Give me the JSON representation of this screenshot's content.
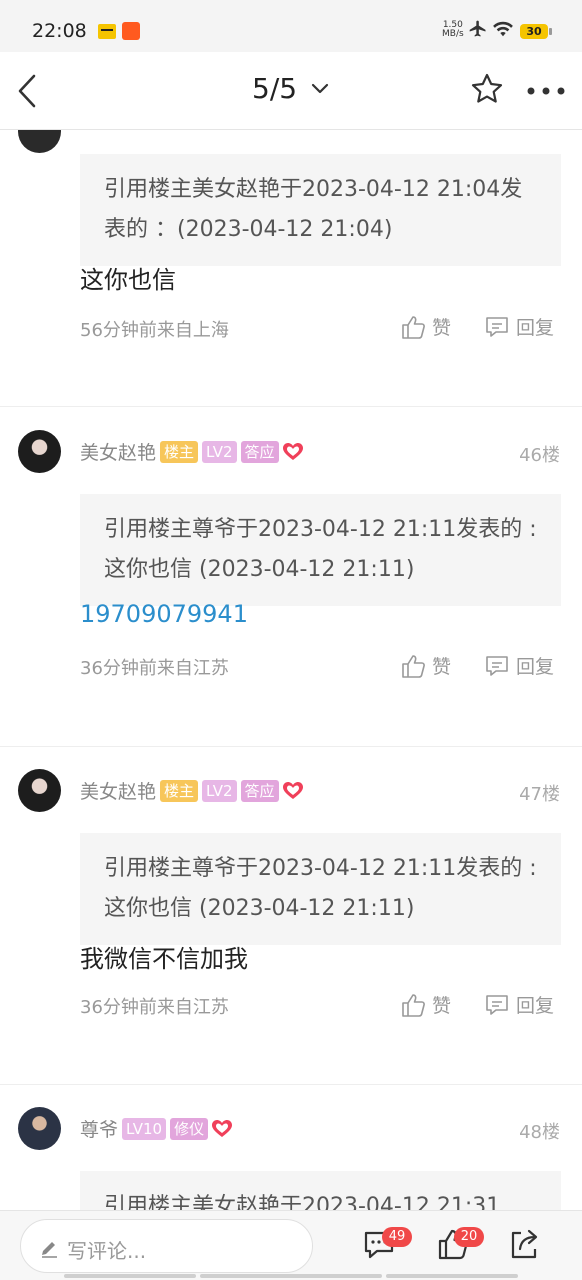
{
  "status_bar": {
    "time": "22:08",
    "net_speed_value": "1.50",
    "net_speed_unit": "MB/s",
    "battery": "30"
  },
  "nav": {
    "page_indicator": "5/5"
  },
  "posts": [
    {
      "quote": "引用楼主美女赵艳于2023-04-12 21:04发表的 ：(2023-04-12 21:04)",
      "content": "这你也信",
      "meta": "56分钟前来自上海",
      "like_label": "赞",
      "reply_label": "回复"
    },
    {
      "author": "美女赵艳",
      "badges": [
        "楼主",
        "LV2",
        "答应"
      ],
      "floor": "46楼",
      "quote": "引用楼主尊爷于2023-04-12 21:11发表的 :这你也信 (2023-04-12 21:11)",
      "content": "19709079941",
      "meta": "36分钟前来自江苏",
      "like_label": "赞",
      "reply_label": "回复"
    },
    {
      "author": "美女赵艳",
      "badges": [
        "楼主",
        "LV2",
        "答应"
      ],
      "floor": "47楼",
      "quote": "引用楼主尊爷于2023-04-12 21:11发表的 :这你也信 (2023-04-12 21:11)",
      "content": "我微信不信加我",
      "meta": "36分钟前来自江苏",
      "like_label": "赞",
      "reply_label": "回复"
    },
    {
      "author": "尊爷",
      "badges": [
        "LV10",
        "修仪"
      ],
      "floor": "48楼",
      "quote": "引用楼主美女赵艳于2023-04-12 21:31"
    }
  ],
  "bottom_bar": {
    "comment_placeholder": "写评论...",
    "comments_count": "49",
    "likes_count": "20"
  },
  "colors": {
    "link": "#2b8ecc",
    "badge_host": "#f7c65a",
    "badge_level": "#e7b7e6",
    "badge_title": "#e2a5dc",
    "heart": "#f0405a",
    "count_badge": "#f04848"
  }
}
